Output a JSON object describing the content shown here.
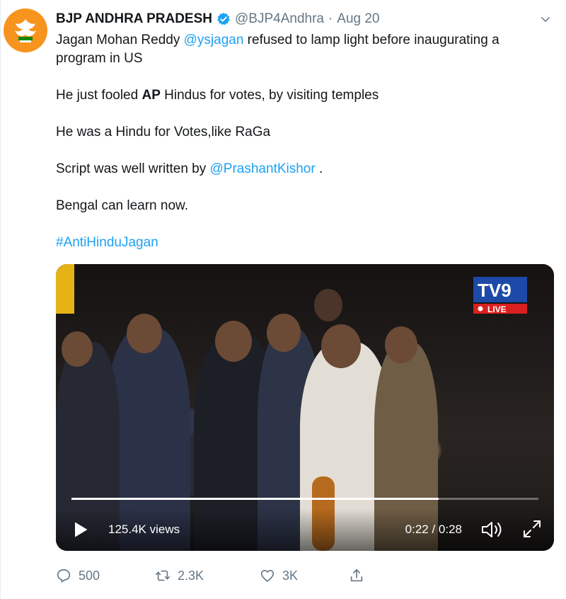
{
  "tweet": {
    "display_name": "BJP ANDHRA PRADESH",
    "handle": "@BJP4Andhra",
    "separator": "·",
    "date": "Aug 20",
    "lines": {
      "l1_pre": "Jagan Mohan Reddy ",
      "l1_mention": "@ysjagan",
      "l1_post": " refused to lamp light before inaugurating a program in US",
      "l2_pre": "He just fooled ",
      "l2_bold": "AP",
      "l2_post": " Hindus for votes, by visiting temples",
      "l3": "He was a Hindu for Votes,like RaGa",
      "l4_pre": "Script was well written by ",
      "l4_mention": "@PrashantKishor",
      "l4_post": " .",
      "l5": "Bengal can learn now.",
      "hashtag": "#AntiHinduJagan"
    }
  },
  "video": {
    "channel_logo": "TV9",
    "channel_live": "LIVE",
    "views": "125.4K views",
    "time": "0:22 / 0:28",
    "progress": 0.786
  },
  "actions": {
    "replies": "500",
    "retweets": "2.3K",
    "likes": "3K"
  },
  "colors": {
    "accent": "#1da1f2",
    "secondary_text": "#657786",
    "avatar_bg": "#f7941d"
  },
  "icons": [
    "bjp-logo-icon",
    "verified-badge-icon",
    "chevron-down-icon",
    "play-icon",
    "volume-icon",
    "expand-icon",
    "reply-icon",
    "retweet-icon",
    "like-icon",
    "share-icon"
  ]
}
